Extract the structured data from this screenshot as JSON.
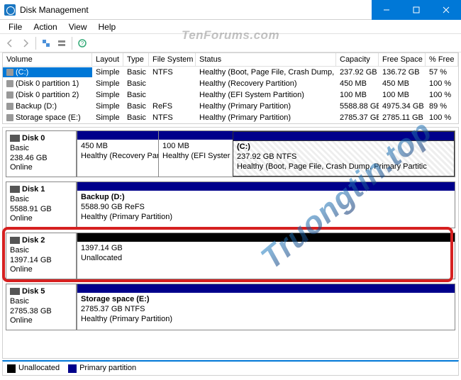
{
  "title": "Disk Management",
  "menu": {
    "file": "File",
    "action": "Action",
    "view": "View",
    "help": "Help"
  },
  "columns": {
    "volume": "Volume",
    "layout": "Layout",
    "type": "Type",
    "fs": "File System",
    "status": "Status",
    "capacity": "Capacity",
    "free": "Free Space",
    "pct": "% Free"
  },
  "volumes": [
    {
      "name": "(C:)",
      "layout": "Simple",
      "type": "Basic",
      "fs": "NTFS",
      "status": "Healthy (Boot, Page File, Crash Dump, Primary Partition)",
      "capacity": "237.92 GB",
      "free": "136.72 GB",
      "pct": "57 %",
      "selected": true
    },
    {
      "name": "(Disk 0 partition 1)",
      "layout": "Simple",
      "type": "Basic",
      "fs": "",
      "status": "Healthy (Recovery Partition)",
      "capacity": "450 MB",
      "free": "450 MB",
      "pct": "100 %"
    },
    {
      "name": "(Disk 0 partition 2)",
      "layout": "Simple",
      "type": "Basic",
      "fs": "",
      "status": "Healthy (EFI System Partition)",
      "capacity": "100 MB",
      "free": "100 MB",
      "pct": "100 %"
    },
    {
      "name": "Backup (D:)",
      "layout": "Simple",
      "type": "Basic",
      "fs": "ReFS",
      "status": "Healthy (Primary Partition)",
      "capacity": "5588.88 GB",
      "free": "4975.34 GB",
      "pct": "89 %"
    },
    {
      "name": "Storage space (E:)",
      "layout": "Simple",
      "type": "Basic",
      "fs": "NTFS",
      "status": "Healthy (Primary Partition)",
      "capacity": "2785.37 GB",
      "free": "2785.11 GB",
      "pct": "100 %"
    }
  ],
  "disks": [
    {
      "name": "Disk 0",
      "type": "Basic",
      "size": "238.46 GB",
      "status": "Online",
      "parts": [
        {
          "w": 115,
          "l1": "450 MB",
          "l2": "Healthy (Recovery Partiti"
        },
        {
          "w": 105,
          "l1": "100 MB",
          "l2": "Healthy (EFI Syster"
        },
        {
          "w": 0,
          "l1": "(C:)",
          "l2": "237.92 GB NTFS",
          "l3": "Healthy (Boot, Page File, Crash Dump, Primary Partitic",
          "selected": true,
          "bold": true
        }
      ]
    },
    {
      "name": "Disk 1",
      "type": "Basic",
      "size": "5588.91 GB",
      "status": "Online",
      "parts": [
        {
          "w": 0,
          "l1": "Backup  (D:)",
          "l2": "5588.90 GB ReFS",
          "l3": "Healthy (Primary Partition)",
          "bold": true
        }
      ]
    },
    {
      "name": "Disk 2",
      "type": "Basic",
      "size": "1397.14 GB",
      "status": "Online",
      "parts": [
        {
          "w": 0,
          "black": true,
          "l2": "1397.14 GB",
          "l3": "Unallocated"
        }
      ]
    },
    {
      "name": "Disk 5",
      "type": "Basic",
      "size": "2785.38 GB",
      "status": "Online",
      "parts": [
        {
          "w": 0,
          "l1": "Storage space  (E:)",
          "l2": "2785.37 GB NTFS",
          "l3": "Healthy (Primary Partition)",
          "bold": true
        }
      ]
    }
  ],
  "legend": {
    "unalloc": "Unallocated",
    "primary": "Primary partition"
  },
  "watermark1": "TenForums.com",
  "watermark2": "Truongtin.top"
}
